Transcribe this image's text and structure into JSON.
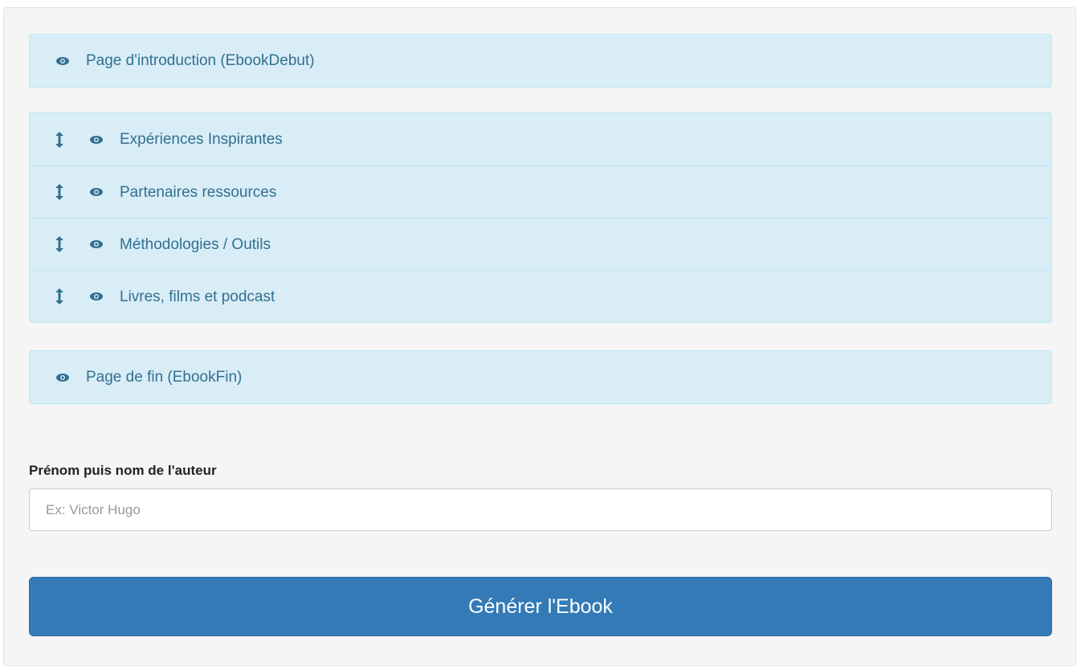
{
  "sections": {
    "intro": {
      "label": "Page d'introduction (EbookDebut)",
      "icon": "eye-icon"
    },
    "chapters": [
      {
        "label": "Expériences Inspirantes",
        "handle_icon": "vertical-resize-icon",
        "icon": "eye-icon"
      },
      {
        "label": "Partenaires ressources",
        "handle_icon": "vertical-resize-icon",
        "icon": "eye-icon"
      },
      {
        "label": "Méthodologies / Outils",
        "handle_icon": "vertical-resize-icon",
        "icon": "eye-icon"
      },
      {
        "label": "Livres, films et podcast",
        "handle_icon": "vertical-resize-icon",
        "icon": "eye-icon"
      }
    ],
    "outro": {
      "label": "Page de fin (EbookFin)",
      "icon": "eye-icon"
    }
  },
  "author": {
    "label": "Prénom puis nom de l'auteur",
    "value": "",
    "placeholder": "Ex: Victor Hugo"
  },
  "actions": {
    "generate_label": "Générer l'Ebook"
  },
  "colors": {
    "panel_bg": "#d9edf7",
    "panel_border": "#bce8f1",
    "panel_text": "#31708f",
    "primary": "#337ab7",
    "well_bg": "#f5f5f5"
  }
}
